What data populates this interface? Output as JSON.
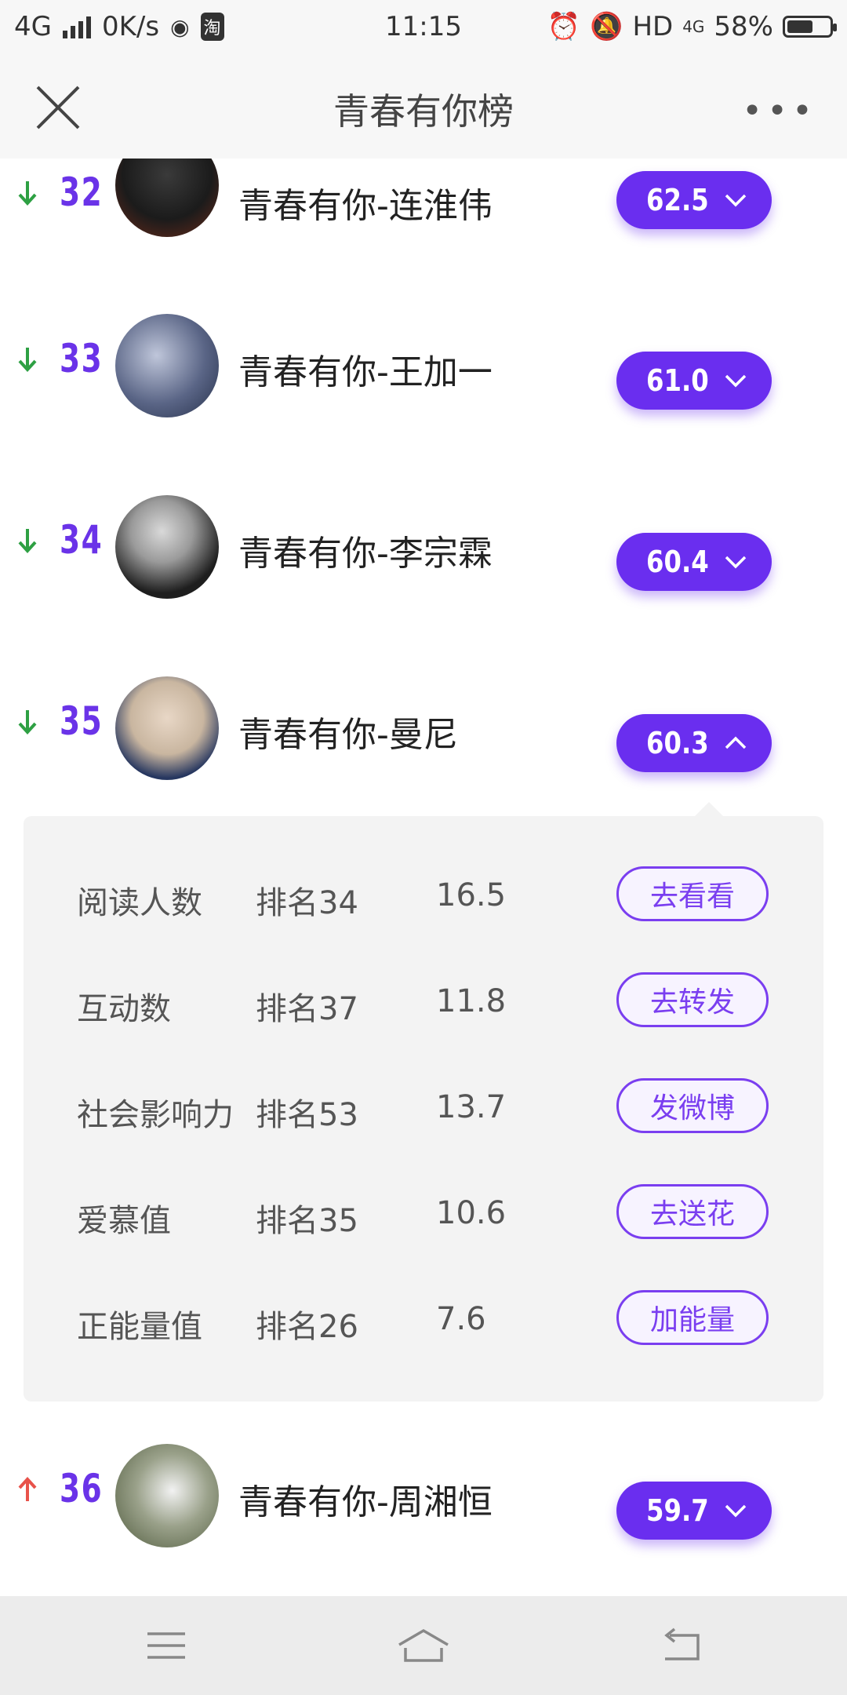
{
  "status": {
    "network": "4G",
    "speed": "0K/s",
    "taobao": "淘",
    "time": "11:15",
    "hd": "HD",
    "net2": "4G",
    "battery": "58%"
  },
  "header": {
    "title": "青春有你榜",
    "more": "•••"
  },
  "accent_color": "#6a2eef",
  "up_color": "#e8524a",
  "down_color": "#2ea043",
  "rows": [
    {
      "rank": "32",
      "name": "青春有你-连淮伟",
      "score": "62.5",
      "trend": "down",
      "expanded": false
    },
    {
      "rank": "33",
      "name": "青春有你-王加一",
      "score": "61.0",
      "trend": "down",
      "expanded": false
    },
    {
      "rank": "34",
      "name": "青春有你-李宗霖",
      "score": "60.4",
      "trend": "down",
      "expanded": false
    },
    {
      "rank": "35",
      "name": "青春有你-曼尼",
      "score": "60.3",
      "trend": "down",
      "expanded": true
    },
    {
      "rank": "36",
      "name": "青春有你-周湘恒",
      "score": "59.7",
      "trend": "up",
      "expanded": false
    }
  ],
  "details": [
    {
      "label": "阅读人数",
      "rank": "排名34",
      "value": "16.5",
      "action": "去看看"
    },
    {
      "label": "互动数",
      "rank": "排名37",
      "value": "11.8",
      "action": "去转发"
    },
    {
      "label": "社会影响力",
      "rank": "排名53",
      "value": "13.7",
      "action": "发微博"
    },
    {
      "label": "爱慕值",
      "rank": "排名35",
      "value": "10.6",
      "action": "去送花"
    },
    {
      "label": "正能量值",
      "rank": "排名26",
      "value": "7.6",
      "action": "加能量"
    }
  ]
}
